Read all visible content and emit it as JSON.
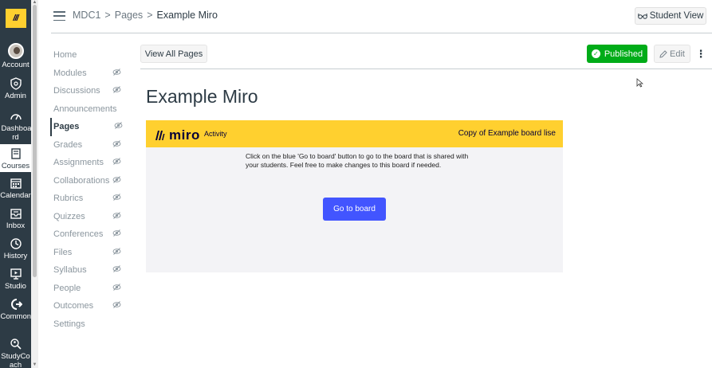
{
  "global_nav": {
    "logo_icon": "miro-logo-icon",
    "items": [
      {
        "label": "Account",
        "icon": "user-avatar"
      },
      {
        "label": "Admin",
        "icon": "shield-icon"
      },
      {
        "label": "Dashboa rd",
        "icon": "dashboard-icon"
      },
      {
        "label": "Courses",
        "icon": "book-icon"
      },
      {
        "label": "Calendar",
        "icon": "calendar-icon"
      },
      {
        "label": "Inbox",
        "icon": "inbox-icon"
      },
      {
        "label": "History",
        "icon": "clock-icon"
      },
      {
        "label": "Studio",
        "icon": "studio-icon"
      },
      {
        "label": "Commons",
        "icon": "commons-icon"
      },
      {
        "label": "StudyCo ach",
        "icon": "search-person-icon"
      }
    ]
  },
  "header": {
    "breadcrumb": [
      "MDC1",
      "Pages",
      "Example Miro"
    ],
    "separator": ">",
    "student_view": "Student View"
  },
  "course_nav": {
    "items": [
      {
        "label": "Home",
        "hidden": false
      },
      {
        "label": "Modules",
        "hidden": true
      },
      {
        "label": "Discussions",
        "hidden": true
      },
      {
        "label": "Announcements",
        "hidden": false
      },
      {
        "label": "Pages",
        "hidden": true,
        "active": true
      },
      {
        "label": "Grades",
        "hidden": true
      },
      {
        "label": "Assignments",
        "hidden": true
      },
      {
        "label": "Collaborations",
        "hidden": true
      },
      {
        "label": "Rubrics",
        "hidden": true
      },
      {
        "label": "Quizzes",
        "hidden": true
      },
      {
        "label": "Conferences",
        "hidden": true
      },
      {
        "label": "Files",
        "hidden": true
      },
      {
        "label": "Syllabus",
        "hidden": true
      },
      {
        "label": "People",
        "hidden": true
      },
      {
        "label": "Outcomes",
        "hidden": true
      },
      {
        "label": "Settings",
        "hidden": false
      }
    ]
  },
  "toolbar": {
    "view_all": "View All Pages",
    "published": "Published",
    "edit": "Edit"
  },
  "page": {
    "title": "Example Miro"
  },
  "miro": {
    "logo_text": "miro",
    "activity": "Activity",
    "copy_title": "Copy of Example board lise",
    "description": "Click on the blue 'Go to board' button to go to the board that is shared with your students. Feel free to make changes to this board if needed.",
    "button": "Go to board",
    "colors": {
      "bar": "#ffd02f",
      "button": "#4255ff"
    }
  },
  "colors": {
    "nav_bg": "#2d3b45",
    "published": "#00ac18"
  }
}
